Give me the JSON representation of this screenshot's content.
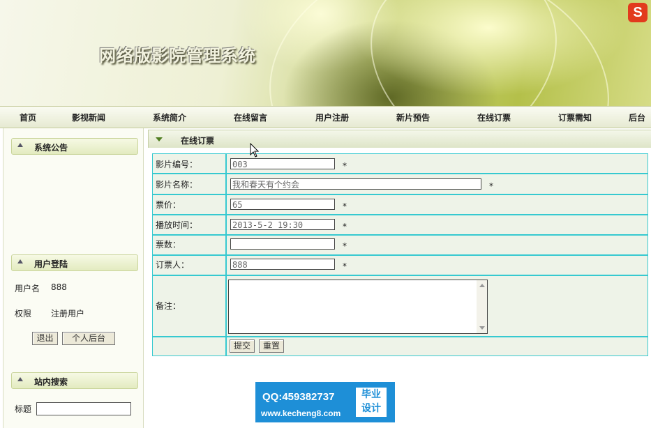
{
  "header": {
    "title": "网络版影院管理系统",
    "logo_letter": "S"
  },
  "nav": {
    "items": [
      "首页",
      "影视新闻",
      "系统简介",
      "在线留言",
      "用户注册",
      "新片预告",
      "在线订票",
      "订票需知",
      "后台"
    ]
  },
  "sidebar": {
    "notice_title": "系统公告",
    "login_title": "用户登陆",
    "username_label": "用户名",
    "username_value": "888",
    "role_label": "权限",
    "role_value": "注册用户",
    "logout_button": "退出",
    "personal_button": "个人后台",
    "search_title": "站内搜索",
    "search_label": "标题",
    "search_value": ""
  },
  "main": {
    "section_title": "在线订票",
    "fields": [
      {
        "label": "影片编号：",
        "value": "003",
        "required": "*"
      },
      {
        "label": "影片名称：",
        "value": "我和春天有个约会",
        "required": "*"
      },
      {
        "label": "票价：",
        "value": "65",
        "required": "*"
      },
      {
        "label": "播放时间：",
        "value": "2013-5-2 19:30",
        "required": "*"
      },
      {
        "label": "票数：",
        "value": "",
        "required": "*"
      },
      {
        "label": "订票人：",
        "value": "888",
        "required": "*"
      }
    ],
    "remark_label": "备注：",
    "remark_value": "",
    "submit_button": "提交",
    "reset_button": "重置"
  },
  "watermark": {
    "qq": "QQ:459382737",
    "url": "www.kecheng8.com",
    "badge_line1": "毕业",
    "badge_line2": "设计"
  }
}
